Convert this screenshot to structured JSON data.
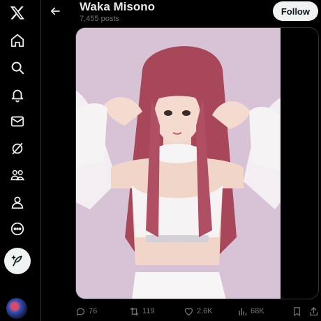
{
  "nav": {
    "items": [
      {
        "name": "x-logo-icon"
      },
      {
        "name": "home-icon"
      },
      {
        "name": "search-icon"
      },
      {
        "name": "notifications-icon"
      },
      {
        "name": "messages-icon"
      },
      {
        "name": "grok-icon"
      },
      {
        "name": "communities-icon"
      },
      {
        "name": "profile-icon"
      },
      {
        "name": "more-icon"
      }
    ],
    "post_button_icon": "compose-post-icon"
  },
  "header": {
    "title": "Waka Misono",
    "subtitle": "7,455 posts",
    "follow_label": "Follow"
  },
  "media": {
    "description_icon": "photo"
  },
  "actions": {
    "replies": "76",
    "reposts": "119",
    "likes": "2.6K",
    "views": "68K"
  },
  "colors": {
    "background": "#000000",
    "text": "#e7e9ea",
    "muted": "#71767b",
    "button_bg": "#eff3f4"
  }
}
